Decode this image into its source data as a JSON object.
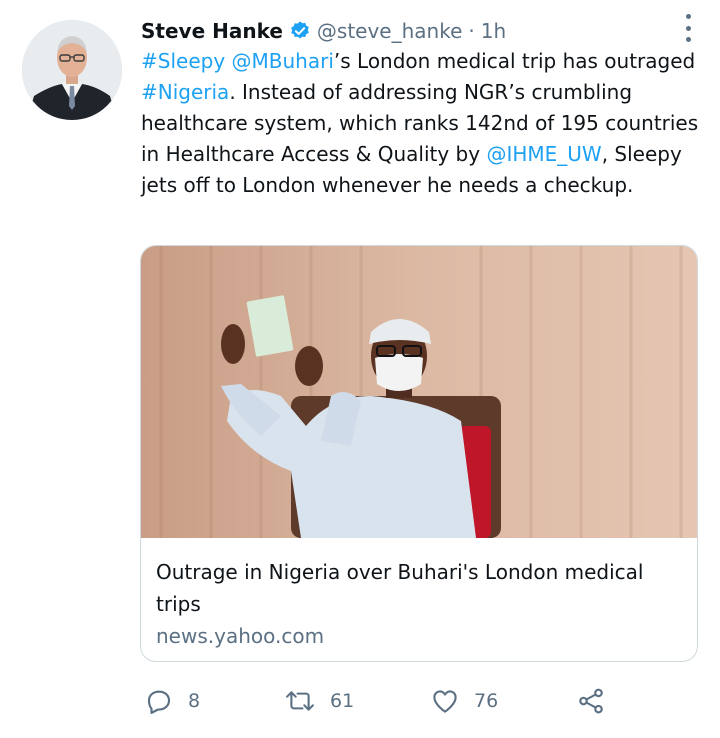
{
  "author": {
    "name": "Steve Hanke",
    "handle": "@steve_hanke",
    "separator": "·",
    "time": "1h",
    "verified_icon": "verified-badge-icon"
  },
  "tweet": {
    "segments": {
      "s1": "#Sleepy",
      "s2": " ",
      "s3": "@MBuhari",
      "s4": "’s London medical trip has outraged ",
      "s5": "#Nigeria",
      "s6": ". Instead of addressing NGR’s crumbling healthcare system, which ranks 142nd of 195 countries in Healthcare Access & Quality by ",
      "s7": "@IHME_UW",
      "s8": ", Sleepy jets off to London whenever he needs a checkup."
    }
  },
  "card": {
    "title": "Outrage in Nigeria over Buhari's London medical trips",
    "domain": "news.yahoo.com"
  },
  "actions": {
    "reply_count": "8",
    "retweet_count": "61",
    "like_count": "76"
  },
  "colors": {
    "link": "#1da1f2",
    "secondary_text": "#5b7083",
    "card_border": "#cfd9de"
  }
}
